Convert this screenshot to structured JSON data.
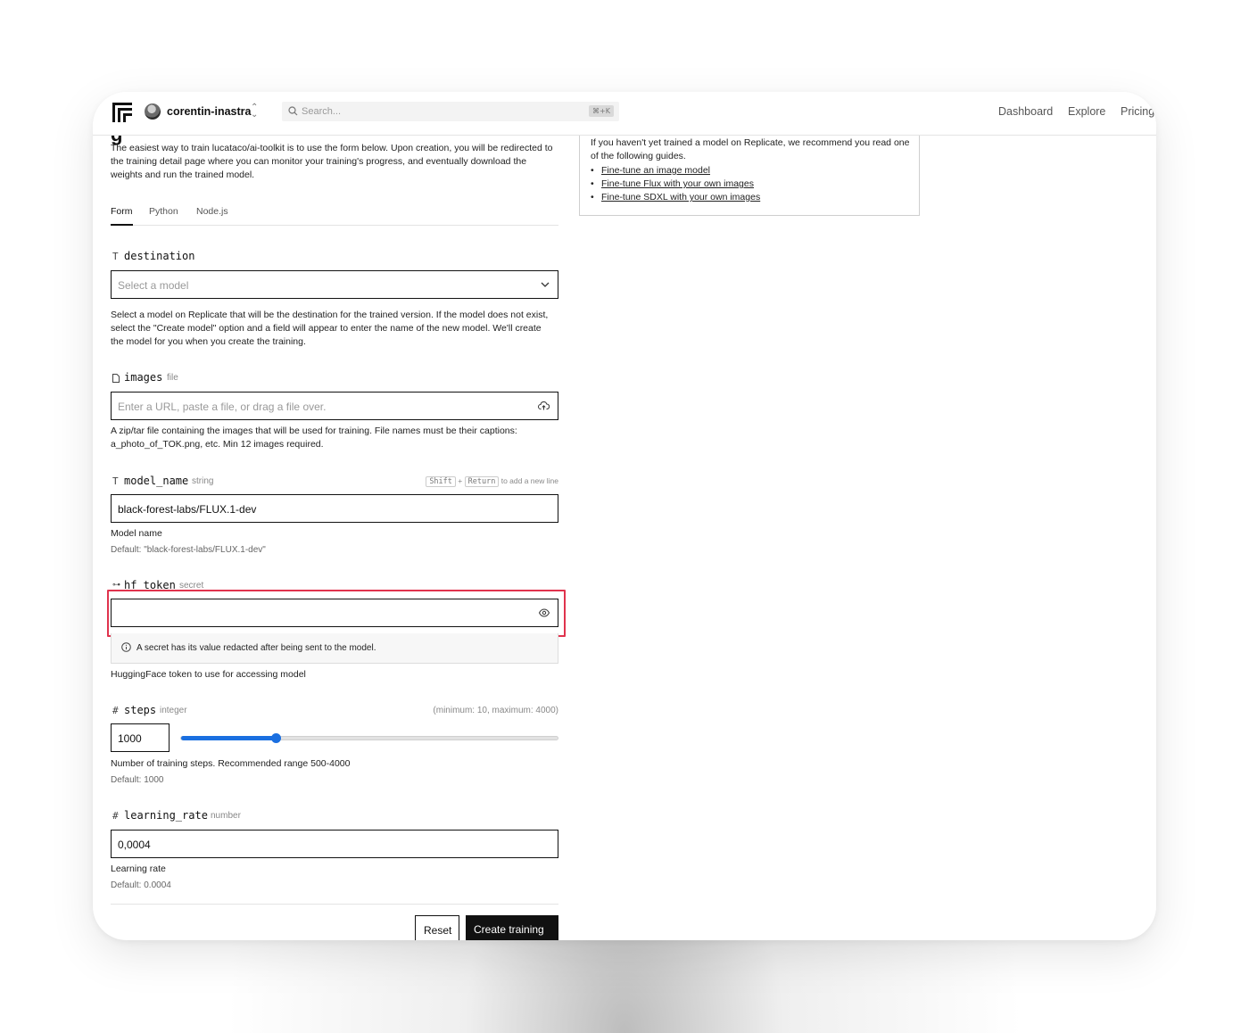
{
  "topbar": {
    "org_name": "corentin-inastra",
    "search_placeholder": "Search...",
    "search_shortcut": "⌘+K",
    "nav": [
      "Dashboard",
      "Explore",
      "Pricing"
    ]
  },
  "intro": {
    "heading_partial": "g",
    "text": "The easiest way to train lucataco/ai-toolkit is to use the form below. Upon creation, you will be redirected to the training detail page where you can monitor your training's progress, and eventually download the weights and run the trained model."
  },
  "tabs": [
    {
      "label": "Form",
      "active": true
    },
    {
      "label": "Python",
      "active": false
    },
    {
      "label": "Node.js",
      "active": false
    }
  ],
  "fields": {
    "destination": {
      "name": "destination",
      "icon": "T",
      "placeholder": "Select a model",
      "description": "Select a model on Replicate that will be the destination for the trained version. If the model does not exist, select the \"Create model\" option and a field will appear to enter the name of the new model. We'll create the model for you when you create the training."
    },
    "images": {
      "name": "images",
      "type": "file",
      "placeholder": "Enter a URL, paste a file, or drag a file over.",
      "description": "A zip/tar file containing the images that will be used for training. File names must be their captions: a_photo_of_TOK.png, etc. Min 12 images required."
    },
    "model_name": {
      "name": "model_name",
      "icon": "T",
      "type": "string",
      "hint_key1": "Shift",
      "hint_plus": "+",
      "hint_key2": "Return",
      "hint_text": "to add a new line",
      "value": "black-forest-labs/FLUX.1-dev",
      "description": "Model name",
      "default": "Default: \"black-forest-labs/FLUX.1-dev\""
    },
    "hf_token": {
      "name": "hf_token",
      "icon": "⊶",
      "type": "secret",
      "value": "",
      "notice": "A secret has its value redacted after being sent to the model.",
      "description": "HuggingFace token to use for accessing model"
    },
    "steps": {
      "name": "steps",
      "icon": "#",
      "type": "integer",
      "range": "(minimum: 10, maximum: 4000)",
      "value": "1000",
      "slider_fraction": 0.25,
      "description": "Number of training steps. Recommended range 500-4000",
      "default": "Default: 1000"
    },
    "learning_rate": {
      "name": "learning_rate",
      "icon": "#",
      "type": "number",
      "value": "0,0004",
      "description": "Learning rate",
      "default": "Default: 0.0004"
    }
  },
  "actions": {
    "reset": "Reset",
    "create": "Create training"
  },
  "guides": {
    "intro": "If you haven't yet trained a model on Replicate, we recommend you read one of the following guides.",
    "items": [
      "Fine-tune an image model",
      "Fine-tune Flux with your own images",
      "Fine-tune SDXL with your own images"
    ]
  },
  "colors": {
    "accent": "#1a6fe0",
    "highlight": "#e0334d",
    "primary_button": "#111111"
  }
}
